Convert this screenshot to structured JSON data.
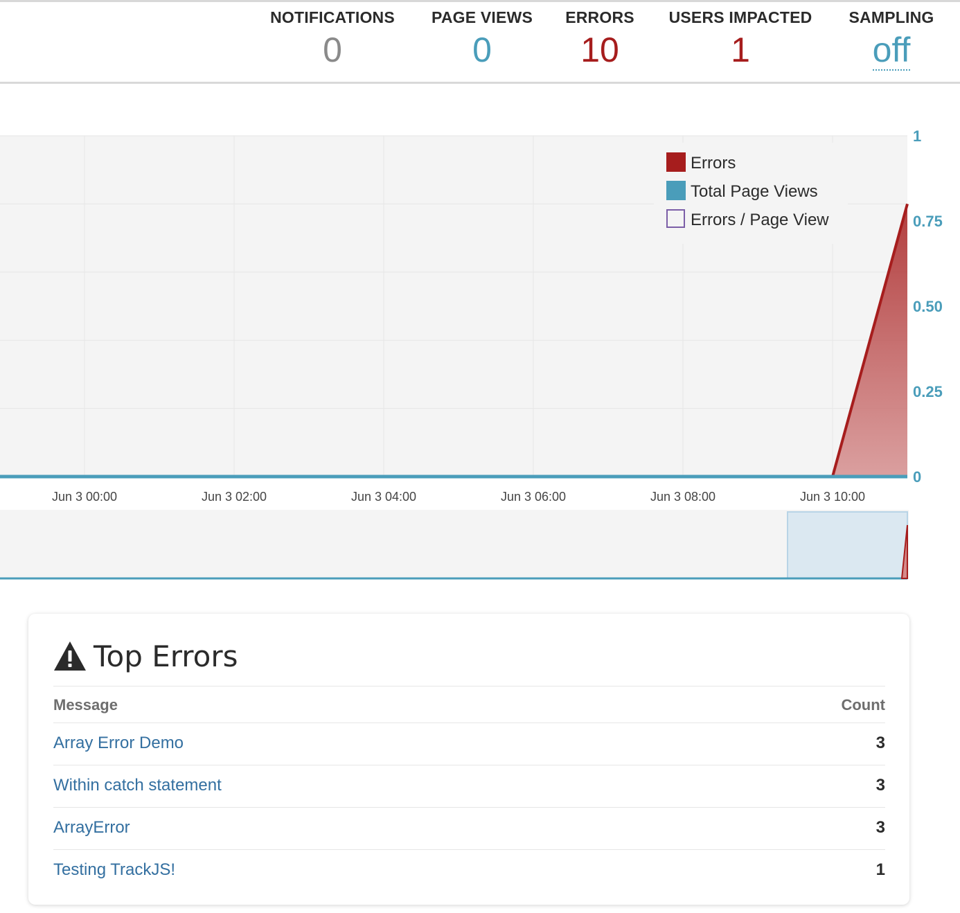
{
  "stats": [
    {
      "label": "NOTIFICATIONS",
      "value": "0",
      "tone": "gray"
    },
    {
      "label": "PAGE VIEWS",
      "value": "0",
      "tone": "blue"
    },
    {
      "label": "ERRORS",
      "value": "10",
      "tone": "red"
    },
    {
      "label": "USERS IMPACTED",
      "value": "1",
      "tone": "red"
    },
    {
      "label": "SAMPLING",
      "value": "off",
      "tone": "link"
    }
  ],
  "colors": {
    "errors": "#a61d1d",
    "page_views": "#4a9dba",
    "errors_per_page_view": "#7b5ea7",
    "link": "#336fa0"
  },
  "chart_data": {
    "type": "area",
    "x": [
      "Jun 3 10:00",
      "Jun 3 11:00"
    ],
    "x_tick_labels": [
      "Jun 3 00:00",
      "Jun 3 02:00",
      "Jun 3 04:00",
      "Jun 3 06:00",
      "Jun 3 08:00",
      "Jun 3 10:00"
    ],
    "y_tick_labels": [
      "1",
      "0.75",
      "0.50",
      "0.25",
      "0"
    ],
    "ylim": [
      0,
      1
    ],
    "grid": true,
    "legend_position": "top-right",
    "series": [
      {
        "name": "Errors",
        "color": "#a61d1d",
        "style": "area",
        "x": [
          "Jun 3 10:00",
          "Jun 3 11:00"
        ],
        "values": [
          0,
          0.8
        ]
      },
      {
        "name": "Total Page Views",
        "color": "#4a9dba",
        "style": "line",
        "values": [
          0,
          0
        ]
      },
      {
        "name": "Errors / Page View",
        "color": "#7b5ea7",
        "style": "line",
        "values": []
      }
    ]
  },
  "top_errors": {
    "icon": "warning-icon",
    "title": "Top Errors",
    "columns": {
      "message": "Message",
      "count": "Count"
    },
    "rows": [
      {
        "message": "Array Error Demo",
        "count": "3"
      },
      {
        "message": "Within catch statement",
        "count": "3"
      },
      {
        "message": "ArrayError",
        "count": "3"
      },
      {
        "message": "Testing TrackJS!",
        "count": "1"
      }
    ]
  }
}
